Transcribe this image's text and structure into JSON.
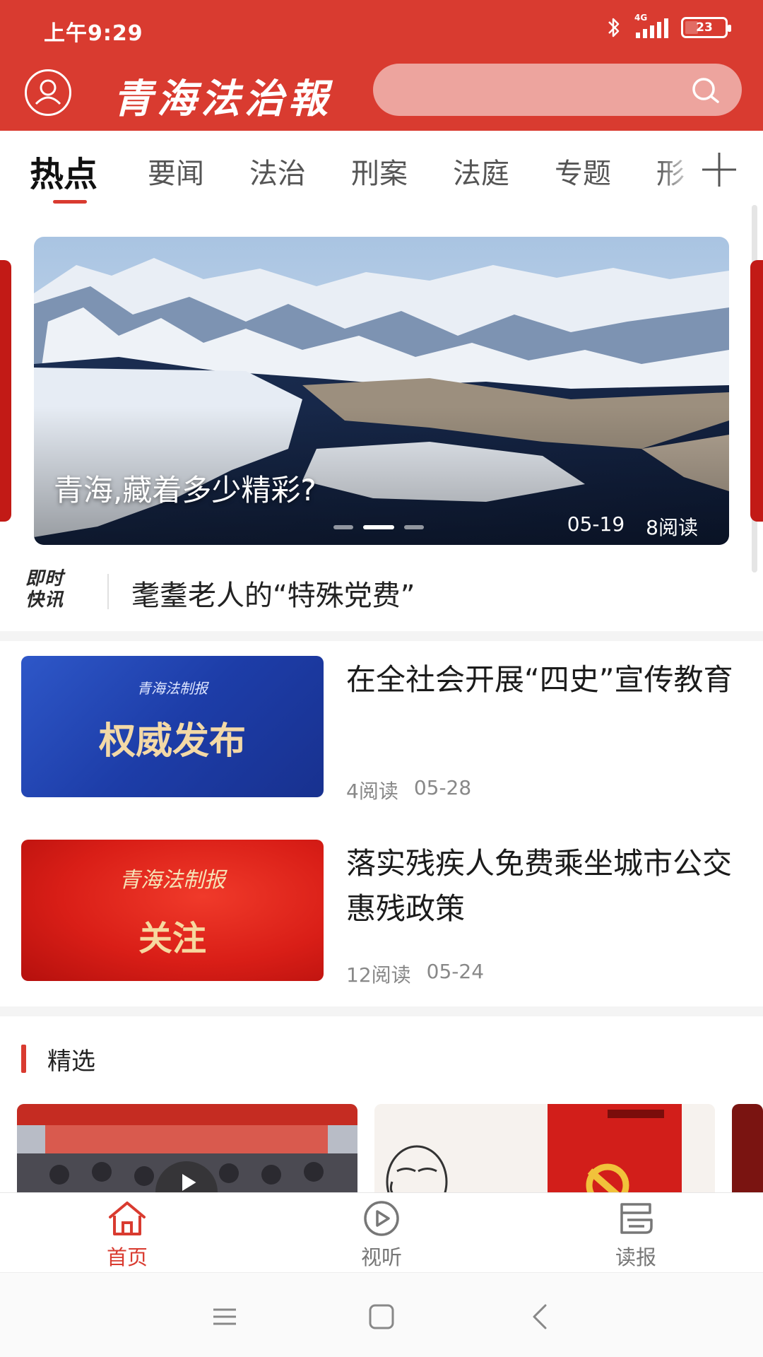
{
  "status_bar": {
    "time": "上午9:29",
    "network": "4G",
    "battery": "23"
  },
  "header": {
    "logo_text": "青海法治報",
    "search_placeholder": ""
  },
  "tabs": [
    {
      "label": "热点",
      "active": true
    },
    {
      "label": "要闻"
    },
    {
      "label": "法治"
    },
    {
      "label": "刑案"
    },
    {
      "label": "法庭"
    },
    {
      "label": "专题"
    },
    {
      "label": "形"
    }
  ],
  "carousel": {
    "title": "青海,藏着多少精彩?",
    "date": "05-19",
    "reads": "8阅读",
    "slide_count": 3,
    "active_slide": 2
  },
  "flash": {
    "badge_line1": "即时",
    "badge_line2": "快讯",
    "headline": "耄耋老人的“特殊党费”"
  },
  "news": [
    {
      "title": "在全社会开展“四史”宣传教育",
      "reads": "4阅读",
      "date": "05-28",
      "thumb_brand": "青海法制报",
      "thumb_text": "权威发布"
    },
    {
      "title": "落实残疾人免费乘坐城市公交惠残政策",
      "reads": "12阅读",
      "date": "05-24",
      "thumb_brand": "青海法制报",
      "thumb_text": "关注"
    }
  ],
  "featured": {
    "section_title": "精选"
  },
  "bottom_nav": [
    {
      "label": "首页",
      "icon": "home-icon",
      "active": true
    },
    {
      "label": "视听",
      "icon": "play-circle-icon"
    },
    {
      "label": "读报",
      "icon": "newspaper-icon"
    }
  ],
  "colors": {
    "brand_red": "#d93b30",
    "search_bg": "#eda49e"
  }
}
